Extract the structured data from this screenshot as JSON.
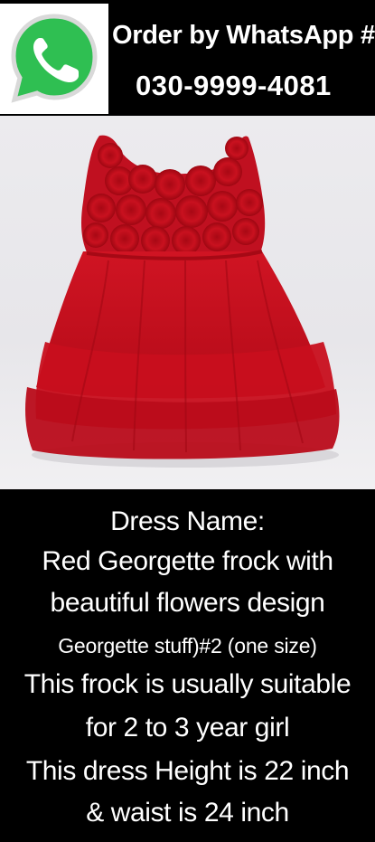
{
  "header": {
    "logo_icon": "whatsapp-icon",
    "order_label": "Order by WhatsApp #",
    "phone_number": "030-9999-4081",
    "colors": {
      "whatsapp_green": "#2fbf52",
      "background": "#000000",
      "text": "#ffffff"
    }
  },
  "photo": {
    "subject": "red-dress-image",
    "colors": {
      "dress_red": "#c8101e",
      "backdrop": "#ebeaed"
    }
  },
  "description": {
    "lines": [
      "Dress Name:",
      "Red Georgette frock with",
      "beautiful flowers design",
      "Georgette stuff)#2 (one size)",
      "This frock is usually suitable",
      "for 2 to 3 year girl",
      "This dress Height is 22 inch",
      "& waist is 24 inch"
    ]
  }
}
